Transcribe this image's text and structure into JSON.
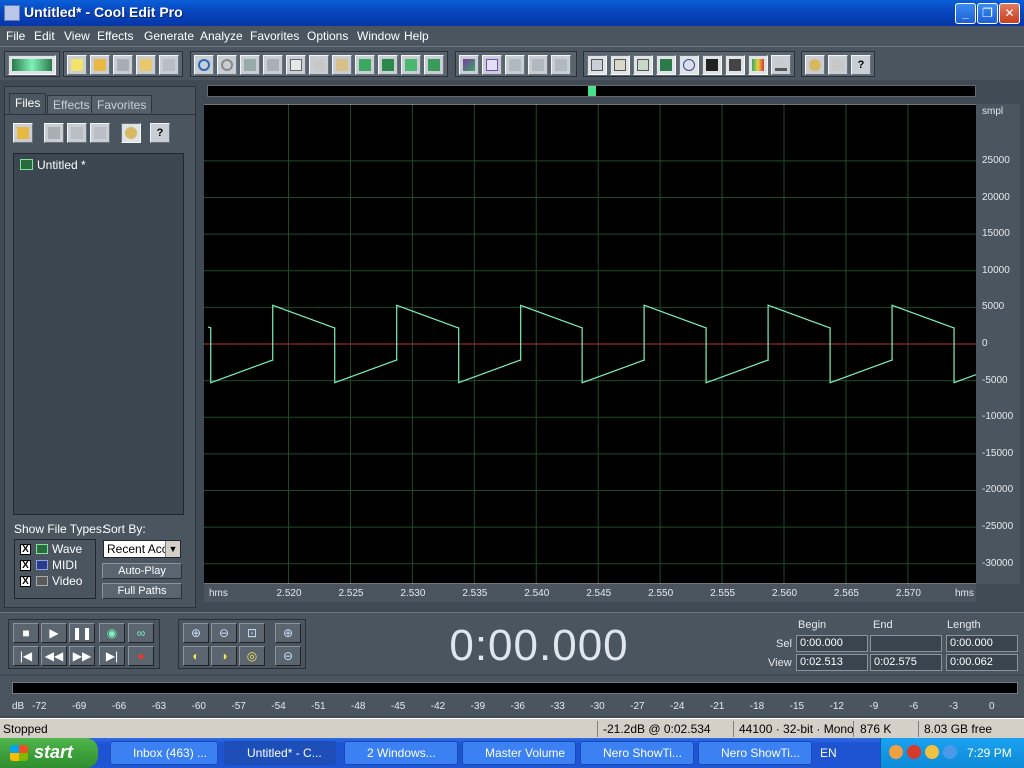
{
  "window": {
    "title": "Untitled* - Cool Edit Pro",
    "minimize": "_",
    "maximize": "❐",
    "close": "✕"
  },
  "menu": [
    "File",
    "Edit",
    "View",
    "Effects",
    "Generate",
    "Analyze",
    "Favorites",
    "Options",
    "Window",
    "Help"
  ],
  "left_panel": {
    "tabs": [
      "Files",
      "Effects",
      "Favorites"
    ],
    "active_tab": "Files",
    "files": [
      {
        "name": "Untitled *"
      }
    ],
    "show_file_types_label": "Show File Types:",
    "sort_by_label": "Sort By:",
    "file_types": [
      {
        "label": "Wave",
        "checked": "X"
      },
      {
        "label": "MIDI",
        "checked": "X"
      },
      {
        "label": "Video",
        "checked": "X"
      }
    ],
    "sort_value": "Recent Acc",
    "autoplay_label": "Auto-Play",
    "fullpaths_label": "Full Paths"
  },
  "waveform": {
    "y_unit": "smpl",
    "y_ticks": [
      "25000",
      "20000",
      "15000",
      "10000",
      "5000",
      "0",
      "-5000",
      "-10000",
      "-15000",
      "-20000",
      "-25000",
      "-30000"
    ],
    "x_unit_left": "hms",
    "x_unit_right": "hms",
    "x_ticks": [
      "2.520",
      "2.525",
      "2.530",
      "2.535",
      "2.540",
      "2.545",
      "2.550",
      "2.555",
      "2.560",
      "2.565",
      "2.570"
    ],
    "colors": {
      "background": "#000000",
      "grid": "#1f4a2a",
      "wave": "#7df2b8",
      "zero_line": "#c0302a",
      "limit_line": "#e8e8e8"
    },
    "x_range": [
      2.5135,
      2.5755
    ],
    "y_range": [
      -32768,
      32767
    ],
    "signal": {
      "shape": "sawtooth-square",
      "period_s": 0.01,
      "first_rise_at_s": 2.5187,
      "high_start": 5300,
      "high_end": 2200,
      "low_start": -5300,
      "low_end": -2200
    }
  },
  "transport": {
    "time": "0:00.000",
    "buttons": [
      "stop",
      "play",
      "pause",
      "play-to-end",
      "loop",
      "go-to-start",
      "rewind",
      "fast-forward",
      "go-to-end",
      "record"
    ],
    "zoom_buttons": [
      "zoom-in-horizontal",
      "zoom-out-horizontal",
      "zoom-full-horizontal",
      "zoom-in-vertical",
      "zoom-to-left",
      "zoom-to-right",
      "zoom-selection",
      "zoom-out-vertical"
    ]
  },
  "selection": {
    "headers": [
      "Begin",
      "End",
      "Length"
    ],
    "rows": [
      {
        "label": "Sel",
        "begin": "0:00.000",
        "end": "",
        "length": "0:00.000"
      },
      {
        "label": "View",
        "begin": "0:02.513",
        "end": "0:02.575",
        "length": "0:00.062"
      }
    ]
  },
  "level_meter": {
    "unit": "dB",
    "ticks": [
      "-72",
      "-69",
      "-66",
      "-63",
      "-60",
      "-57",
      "-54",
      "-51",
      "-48",
      "-45",
      "-42",
      "-39",
      "-36",
      "-33",
      "-30",
      "-27",
      "-24",
      "-21",
      "-18",
      "-15",
      "-12",
      "-9",
      "-6",
      "-3",
      "0"
    ]
  },
  "status": {
    "state": "Stopped",
    "cursor": "-21.2dB @  0:02.534",
    "format": "44100 · 32-bit · Mono",
    "size": "876 K",
    "free": "8.03 GB free"
  },
  "taskbar": {
    "start": "start",
    "tasks": [
      {
        "label": "Inbox (463) ...",
        "icon_color": "#e8702a"
      },
      {
        "label": "Untitled* - C...",
        "icon_color": "#9aa8d6"
      },
      {
        "label": "2 Windows...",
        "icon_color": "#f0c860"
      },
      {
        "label": "Master Volume",
        "icon_color": "#c8c8c8"
      },
      {
        "label": "Nero ShowTi...",
        "icon_color": "#f0d040"
      },
      {
        "label": "Nero ShowTi...",
        "icon_color": "#f0d040"
      }
    ],
    "language": "EN",
    "clock": "7:29 PM"
  }
}
